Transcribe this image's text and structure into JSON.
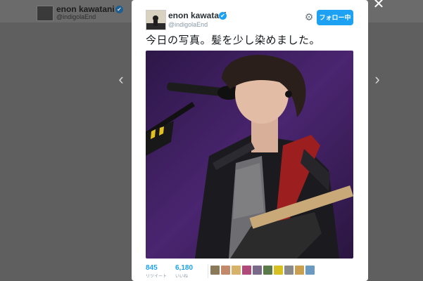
{
  "background_profile": {
    "name": "enon kawatani",
    "handle": "@indigolaEnd",
    "verified_glyph": "✔"
  },
  "navigation": {
    "prev_glyph": "‹",
    "next_glyph": "›",
    "close_glyph": "✕"
  },
  "tweet": {
    "author": {
      "name": "enon kawatani",
      "handle": "@indigolaEnd",
      "verified_glyph": "✔"
    },
    "gear_glyph": "⚙",
    "follow_button_label": "フォロー中",
    "text": "今日の写真。髪を少し染めました。",
    "stats": {
      "retweets_count": "845",
      "retweets_label": "リツイート",
      "likes_count": "6,180",
      "likes_label": "いいね"
    },
    "liker_avatar_colors": [
      "#8a7a5a",
      "#c28a6a",
      "#d7b26a",
      "#b04a7a",
      "#7a6a8a",
      "#5a7a4a",
      "#d8c020",
      "#8a8a8a",
      "#c8a050",
      "#6a9ac0"
    ]
  },
  "colors": {
    "accent": "#1da1f2",
    "overlay": "#5f5f5f",
    "photo_background": "#3c1f5a"
  }
}
